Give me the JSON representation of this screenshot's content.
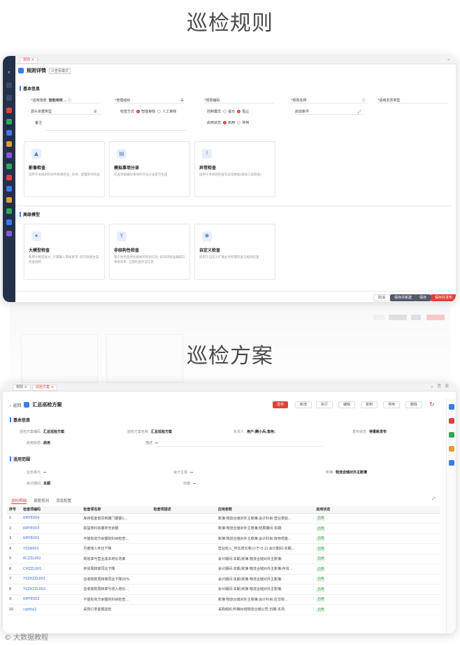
{
  "heading_top": "巡检规则",
  "heading_mid": "巡检方案",
  "watermark": "© 大数据教程",
  "rule": {
    "tab": "规则",
    "title": "规则详情",
    "tag": "只查看模式",
    "section_basic": "基本信息",
    "fields": {
      "scene_label": "适用场景",
      "scene_value": "智能审核",
      "org_label": "管理组织",
      "code_label": "规则编码",
      "name_label": "规则名称",
      "doc_type_label": "源头单据类型",
      "check_method_label": "检查方式",
      "check_opt1": "智能审核",
      "check_opt2": "人工审核",
      "control_label": "控制模式",
      "control_opt1": "提示",
      "control_opt2": "阻止",
      "enable_label": "启用状态",
      "enable_opt1": "启用",
      "enable_opt2": "停用",
      "start_label": "启动条件",
      "remark_label": "备注",
      "invoice_label": "适用发票类型"
    },
    "cards1": [
      {
        "icon": "image-icon",
        "title": "影像检查",
        "desc": "适用于本规则的附件影像检查, 支持、配置附件检查"
      },
      {
        "icon": "document-icon",
        "title": "模拟事项分录",
        "desc": "检查单据模拟事项的凭证分录是否生成"
      },
      {
        "icon": "alert-icon",
        "title": "异常检查",
        "desc": "适用于本规则检查在异常数据(基本工具检查)"
      }
    ],
    "section_model": "高级模型",
    "cards2": [
      {
        "icon": "ai-icon",
        "title": "大模型检查",
        "desc": "利用大模型能力, 只需输入审核要求, 即可快速生成检查规则"
      },
      {
        "icon": "ledger-icon",
        "title": "非结构性检查",
        "desc": "基于财务及财务相关的检验信息, 提高审核准确度与审核效率, 全面检查凭证信息"
      },
      {
        "icon": "custom-icon",
        "title": "自定义检查",
        "desc": "适用于自定义扩展业务所需检查与规则检查"
      }
    ],
    "buttons": [
      "取消",
      "保存并新建",
      "保存",
      "保存并发布"
    ]
  },
  "plan": {
    "tab1": "规则",
    "tab2": "巡检方案",
    "back": "返回",
    "title": "汇总巡检方案",
    "actions": [
      "发布",
      "新增",
      "执行",
      "编辑",
      "复制",
      "停用",
      "删除"
    ],
    "section_basic": "基本信息",
    "basic": [
      {
        "k": "巡检方案编码",
        "v": "汇总巡检方案"
      },
      {
        "k": "巡检方案名称",
        "v": "汇总巡检方案"
      },
      {
        "k": "负责人",
        "v": "用户:腾小兵;角色:"
      },
      {
        "k": "发布状态",
        "v": "待重新发布"
      },
      {
        "k": "启用状态",
        "v": "启用"
      },
      {
        "k": "描述",
        "v": "--"
      }
    ],
    "section_scope": "适用范围",
    "scope": [
      {
        "k": "业务单元",
        "v": "--"
      },
      {
        "k": "会计主体",
        "v": "--"
      },
      {
        "k": "账簿",
        "v": "物流合储对外主账簿"
      },
      {
        "k": "会计期间",
        "v": "本期"
      },
      {
        "k": "日期",
        "v": "--"
      }
    ],
    "subtabs": [
      "巡检明细",
      "调度规则",
      "消息配置"
    ],
    "columns": [
      "序号",
      "检查项编码",
      "检查项名称",
      "检查项描述",
      "应用参数",
      "启用状态"
    ],
    "rows": [
      [
        "1",
        "KMYE004",
        "库存现金借贷到期门额额1...",
        "",
        "账簿:物流合储对外主账簿;会计科目:营业费如...",
        "启用"
      ],
      [
        "2",
        "KMYE003",
        "损益类科目期末无余额",
        "",
        "账簿:物流合储对外主账簿;结果期间:本期;",
        "启用"
      ],
      [
        "3",
        "KMYE001",
        "不能有资方余额的科目检查...",
        "",
        "账簿:物流合储对外主账簿;会计科目:库存现金...",
        "启用"
      ],
      [
        "4",
        "YZSR001",
        "月度收入环比下降",
        "",
        "营业收入_环比增长率(小于-0.2);会计期间:本期...",
        "启用"
      ],
      [
        "5",
        "KCZZL002",
        "规划率与营业成本增长背离",
        "",
        "会计期间:本期;账簿:物流合储对外主账簿;",
        "启用"
      ],
      [
        "6",
        "CHZZL001",
        "存货周转率同比下降",
        "",
        "会计期间:本期;账簿:物流合储对外主账簿;存货...",
        "启用"
      ],
      [
        "7",
        "YSZKZZL001",
        "应收账款周转率同比下降20%",
        "",
        "会计期间:本期;账簿:物流合储对外主账簿;",
        "启用"
      ],
      [
        "8",
        "YSZKZZL002",
        "应收账款周转率与收入增长...",
        "",
        "会计期间:本期;账簿:物流合储对外主账簿;",
        "启用"
      ],
      [
        "9",
        "KMYE002",
        "不能有资方余额的科目检查...",
        "",
        "账簿:物流合储对外主账簿;会计科目:应交财...",
        "启用"
      ],
      [
        "10",
        "cgddsj1",
        "采购订单金额巡检",
        "",
        "采购组织:料粮纠结物流合储公司;日期:本月;",
        "启用"
      ]
    ]
  }
}
